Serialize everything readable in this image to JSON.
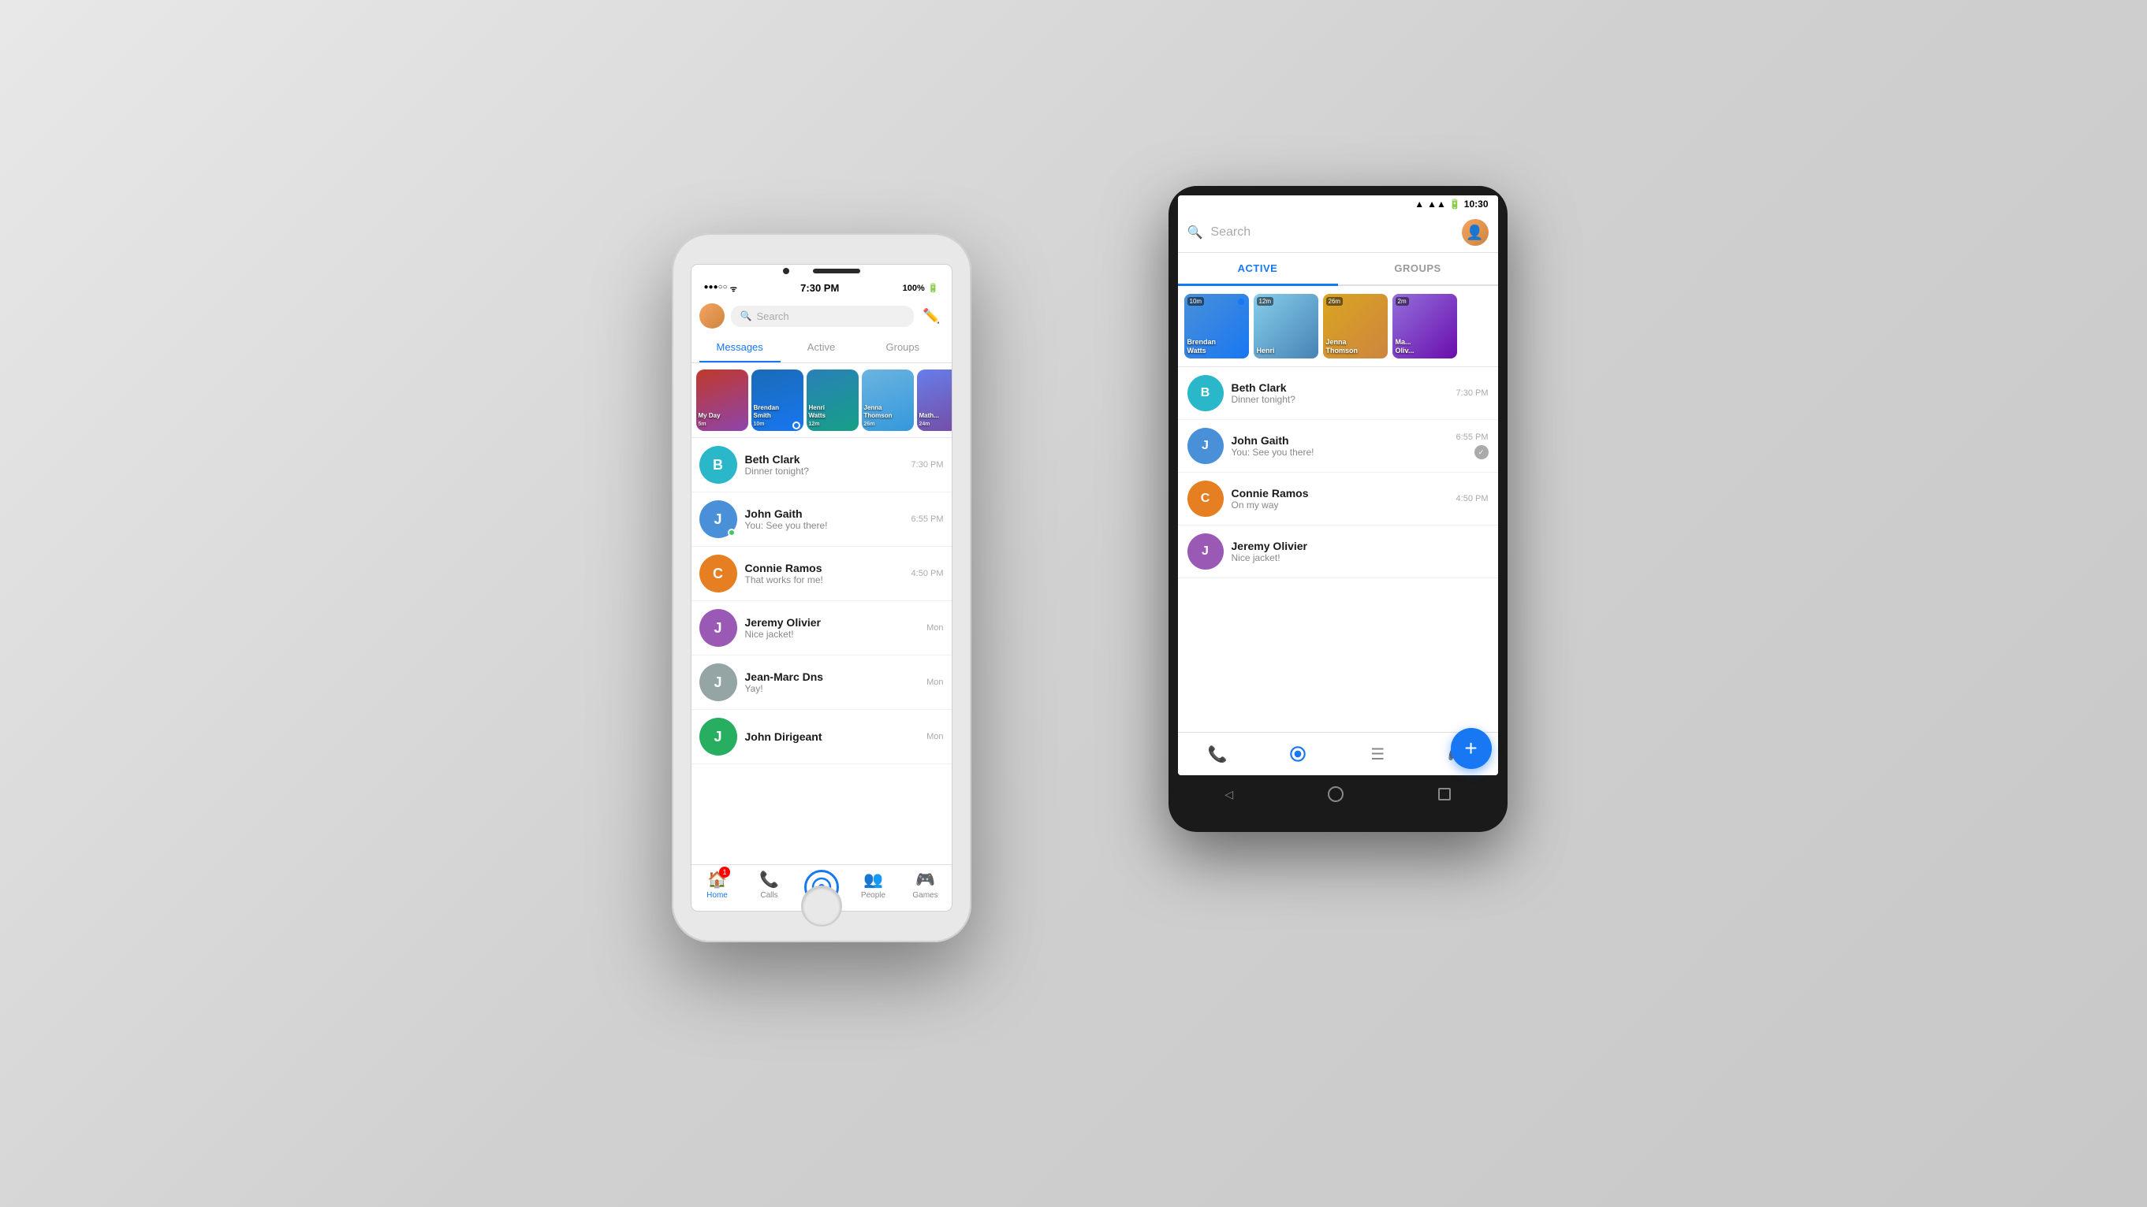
{
  "scene": {
    "background": "light gray gradient"
  },
  "ios": {
    "statusBar": {
      "carrier": "•••○○",
      "wifi": "WiFi",
      "time": "7:30 PM",
      "battery": "100%"
    },
    "searchPlaceholder": "Search",
    "tabs": {
      "messages": "Messages",
      "active": "Active",
      "groups": "Groups"
    },
    "stories": [
      {
        "name": "My Day",
        "time": "5m",
        "hasDot": false
      },
      {
        "name": "Brendan Smith",
        "time": "10m",
        "hasDot": true
      },
      {
        "name": "Henri Watts",
        "time": "12m",
        "hasDot": false
      },
      {
        "name": "Jenna Thomson",
        "time": "26m",
        "hasDot": false
      },
      {
        "name": "Math...",
        "time": "24m",
        "hasDot": false
      }
    ],
    "conversations": [
      {
        "name": "Beth Clark",
        "preview": "Dinner tonight?",
        "time": "7:30 PM",
        "avatarBg": "av-teal",
        "online": false
      },
      {
        "name": "John Gaith",
        "preview": "You: See you there!",
        "time": "6:55 PM",
        "avatarBg": "av-blue",
        "online": true
      },
      {
        "name": "Connie Ramos",
        "preview": "That works for me!",
        "time": "4:50 PM",
        "avatarBg": "av-orange",
        "online": false
      },
      {
        "name": "Jeremy Olivier",
        "preview": "Nice jacket!",
        "time": "Mon",
        "avatarBg": "av-purple",
        "online": false
      },
      {
        "name": "Jean-Marc Dns",
        "preview": "Yay!",
        "time": "Mon",
        "avatarBg": "av-gray",
        "online": false
      },
      {
        "name": "John Dirigeant",
        "preview": "",
        "time": "Mon",
        "avatarBg": "av-green",
        "online": false
      }
    ],
    "bottomNav": [
      {
        "label": "Home",
        "active": true,
        "badge": "1"
      },
      {
        "label": "Calls",
        "active": false,
        "badge": null
      },
      {
        "label": "",
        "active": false,
        "badge": null,
        "isCenter": true
      },
      {
        "label": "People",
        "active": false,
        "badge": null
      },
      {
        "label": "Games",
        "active": false,
        "badge": null
      }
    ]
  },
  "android": {
    "statusBar": {
      "time": "10:30",
      "batteryPct": "●●●"
    },
    "searchPlaceholder": "Search",
    "tabs": {
      "active": "ACTIVE",
      "groups": "GROUPS"
    },
    "stories": [
      {
        "name": "Brendan\nWatts",
        "time": "10m",
        "hasDot": true
      },
      {
        "name": "Henri",
        "time": "12m",
        "hasDot": false
      },
      {
        "name": "Jenna\nThomson",
        "time": "26m",
        "hasDot": false
      },
      {
        "name": "Ma...\nOliv...",
        "time": "2m",
        "hasDot": false
      }
    ],
    "conversations": [
      {
        "name": "Beth Clark",
        "preview": "Dinner tonight?",
        "time": "7:30 PM",
        "avatarBg": "av-teal"
      },
      {
        "name": "John Gaith",
        "preview": "You: See you there!",
        "time": "6:55 PM",
        "avatarBg": "av-blue",
        "hasReceipt": true
      },
      {
        "name": "Connie Ramos",
        "preview": "On my way",
        "time": "4:50 PM",
        "avatarBg": "av-orange"
      },
      {
        "name": "Jeremy Olivier",
        "preview": "Nice jacket!",
        "time": "",
        "avatarBg": "av-purple"
      }
    ],
    "fab": "+",
    "bottomNav": [
      {
        "icon": "phone",
        "active": false
      },
      {
        "icon": "home",
        "active": true
      },
      {
        "icon": "list",
        "active": false
      },
      {
        "icon": "games",
        "active": false
      }
    ]
  }
}
